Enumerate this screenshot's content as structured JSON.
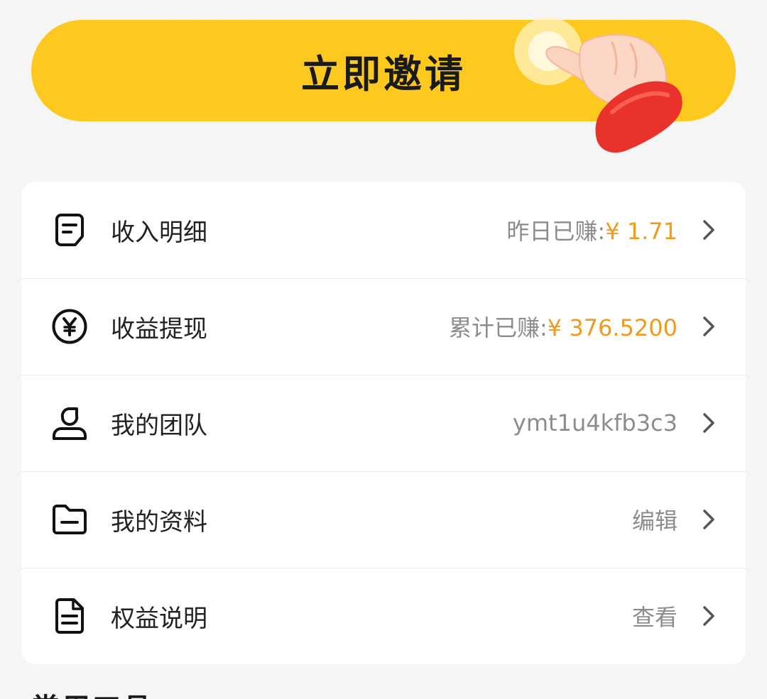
{
  "invite": {
    "label": "立即邀请"
  },
  "menu": [
    {
      "id": "income",
      "icon": "receipt-icon",
      "label": "收入明细",
      "value_prefix": "昨日已赚:",
      "value_amount": "¥ 1.71"
    },
    {
      "id": "withdraw",
      "icon": "yen-circle-icon",
      "label": "收益提现",
      "value_prefix": "累计已赚:",
      "value_amount": "¥ 376.5200"
    },
    {
      "id": "team",
      "icon": "person-icon",
      "label": "我的团队",
      "value_text": "ymt1u4kfb3c3"
    },
    {
      "id": "profile",
      "icon": "folder-icon",
      "label": "我的资料",
      "value_text": "编辑"
    },
    {
      "id": "benefits",
      "icon": "document-icon",
      "label": "权益说明",
      "value_text": "查看"
    }
  ],
  "colors": {
    "banner": "#fdc91e",
    "amount": "#f19a1d",
    "muted": "#8c8c8c"
  },
  "next_section": {
    "title": "常用工具"
  }
}
